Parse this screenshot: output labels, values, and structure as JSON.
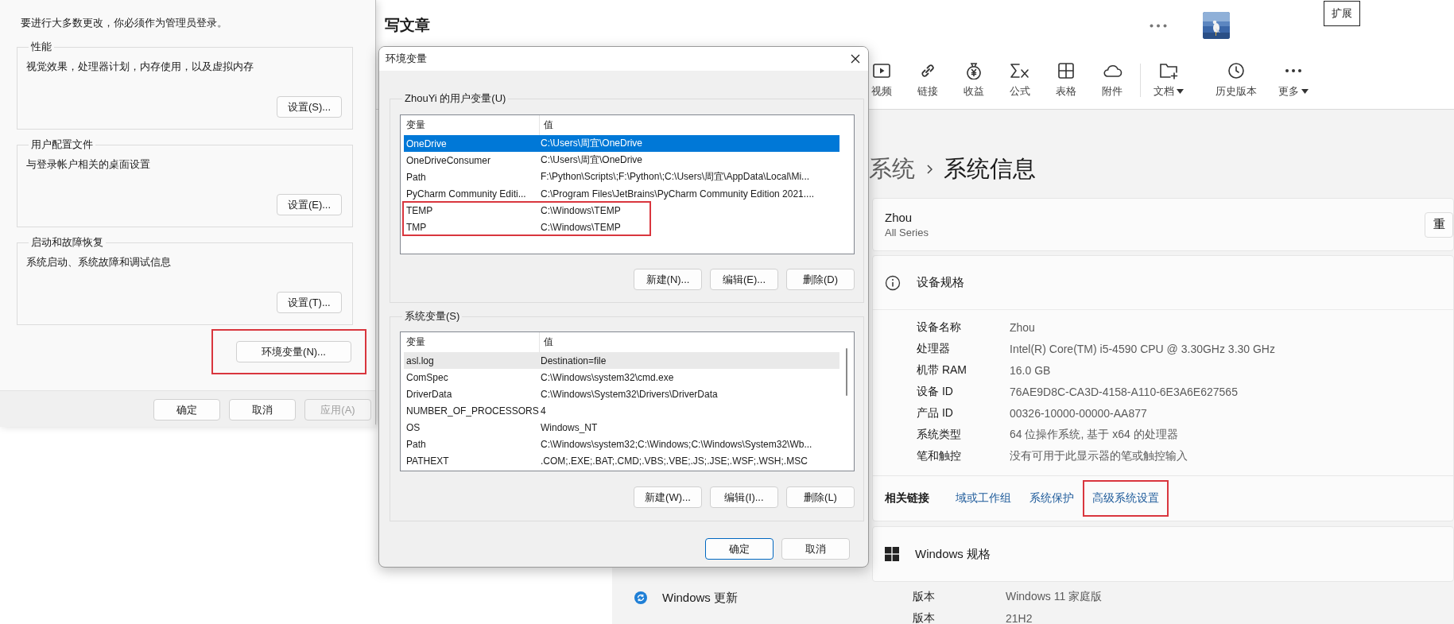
{
  "editor": {
    "title": "写文章",
    "tooltip": "扩展",
    "toolbar": [
      {
        "label": "视频",
        "kind": "video",
        "dropdown": false
      },
      {
        "label": "链接",
        "kind": "link",
        "dropdown": false
      },
      {
        "label": "收益",
        "kind": "money",
        "dropdown": false
      },
      {
        "label": "公式",
        "kind": "formula",
        "dropdown": false
      },
      {
        "label": "表格",
        "kind": "table",
        "dropdown": false
      },
      {
        "label": "附件",
        "kind": "cloud",
        "dropdown": false
      },
      {
        "label": "文档",
        "kind": "folder",
        "dropdown": true
      },
      {
        "label": "历史版本",
        "kind": "clock",
        "dropdown": false
      },
      {
        "label": "更多",
        "kind": "more",
        "dropdown": true
      }
    ]
  },
  "settings": {
    "nav": [
      {
        "label": "Windows 更新",
        "kind": "update"
      }
    ],
    "breadcrumb": [
      "系统",
      "系统信息"
    ],
    "device": {
      "name": "Zhou",
      "model": "All Series",
      "rename_button": "重"
    },
    "device_specs": {
      "title": "设备规格",
      "rows": [
        {
          "label": "设备名称",
          "value": "Zhou"
        },
        {
          "label": "处理器",
          "value": "Intel(R) Core(TM) i5-4590 CPU @ 3.30GHz   3.30 GHz"
        },
        {
          "label": "机带 RAM",
          "value": "16.0 GB"
        },
        {
          "label": "设备 ID",
          "value": "76AE9D8C-CA3D-4158-A110-6E3A6E627565"
        },
        {
          "label": "产品 ID",
          "value": "00326-10000-00000-AA877"
        },
        {
          "label": "系统类型",
          "value": "64 位操作系统, 基于 x64 的处理器"
        },
        {
          "label": "笔和触控",
          "value": "没有可用于此显示器的笔或触控输入"
        }
      ]
    },
    "related_links": {
      "label": "相关链接",
      "links": [
        {
          "text": "域或工作组",
          "outlined": false
        },
        {
          "text": "系统保护",
          "outlined": false
        },
        {
          "text": "高级系统设置",
          "outlined": true
        }
      ]
    },
    "windows_specs": {
      "title": "Windows 规格",
      "rows": [
        {
          "label": "版本",
          "value": "Windows 11 家庭版"
        },
        {
          "label": "版本",
          "value": "21H2"
        }
      ]
    }
  },
  "system_properties": {
    "notice": "要进行大多数更改，你必须作为管理员登录。",
    "groups": [
      {
        "title": "性能",
        "description": "视觉效果，处理器计划，内存使用，以及虚拟内存",
        "button": "设置(S)..."
      },
      {
        "title": "用户配置文件",
        "description": "与登录帐户相关的桌面设置",
        "button": "设置(E)..."
      },
      {
        "title": "启动和故障恢复",
        "description": "系统启动、系统故障和调试信息",
        "button": "设置(T)..."
      }
    ],
    "env_button": {
      "label": "环境变量(N)...",
      "outlined": true
    },
    "buttons": [
      {
        "label": "确定",
        "disabled": false
      },
      {
        "label": "取消",
        "disabled": false
      },
      {
        "label": "应用(A)",
        "disabled": true
      }
    ]
  },
  "environment_variables": {
    "title": "环境变量",
    "user_variables": {
      "title": "ZhouYi 的用户变量(U)",
      "columns": [
        "变量",
        "值"
      ],
      "rows": [
        {
          "name": "OneDrive",
          "value": "C:\\Users\\周宜\\OneDrive",
          "selected": true,
          "outlined": false
        },
        {
          "name": "OneDriveConsumer",
          "value": "C:\\Users\\周宜\\OneDrive",
          "selected": false,
          "outlined": false
        },
        {
          "name": "Path",
          "value": "F:\\Python\\Scripts\\;F:\\Python\\;C:\\Users\\周宜\\AppData\\Local\\Mi...",
          "selected": false,
          "outlined": false
        },
        {
          "name": "PyCharm Community Editi...",
          "value": "C:\\Program Files\\JetBrains\\PyCharm Community Edition 2021....",
          "selected": false,
          "outlined": false
        },
        {
          "name": "TEMP",
          "value": "C:\\Windows\\TEMP",
          "selected": false,
          "outlined": true
        },
        {
          "name": "TMP",
          "value": "C:\\Windows\\TEMP",
          "selected": false,
          "outlined": true
        }
      ],
      "buttons": [
        "新建(N)...",
        "编辑(E)...",
        "删除(D)"
      ]
    },
    "system_variables": {
      "title": "系统变量(S)",
      "columns": [
        "变量",
        "值"
      ],
      "rows": [
        {
          "name": "asl.log",
          "value": "Destination=file",
          "selected": true
        },
        {
          "name": "ComSpec",
          "value": "C:\\Windows\\system32\\cmd.exe",
          "selected": false
        },
        {
          "name": "DriverData",
          "value": "C:\\Windows\\System32\\Drivers\\DriverData",
          "selected": false
        },
        {
          "name": "NUMBER_OF_PROCESSORS",
          "value": "4",
          "selected": false
        },
        {
          "name": "OS",
          "value": "Windows_NT",
          "selected": false
        },
        {
          "name": "Path",
          "value": "C:\\Windows\\system32;C:\\Windows;C:\\Windows\\System32\\Wb...",
          "selected": false
        },
        {
          "name": "PATHEXT",
          "value": ".COM;.EXE;.BAT;.CMD;.VBS;.VBE;.JS;.JSE;.WSF;.WSH;.MSC",
          "selected": false
        }
      ],
      "buttons": [
        "新建(W)...",
        "编辑(I)...",
        "删除(L)"
      ]
    },
    "buttons": [
      {
        "label": "确定",
        "default": true
      },
      {
        "label": "取消",
        "default": false
      }
    ]
  }
}
